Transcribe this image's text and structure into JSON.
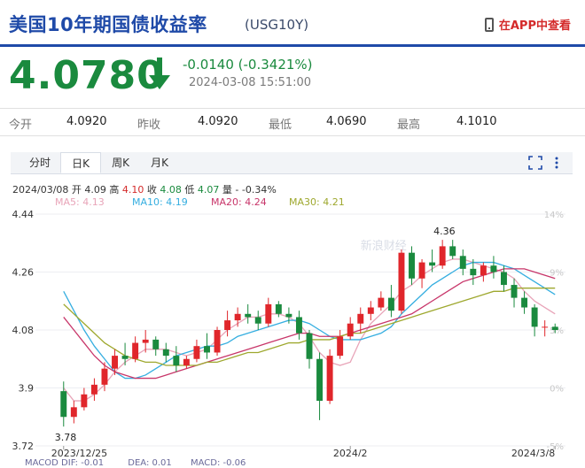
{
  "header": {
    "title": "美国10年期国债收益率",
    "code": "(USG10Y)",
    "app_link": "在APP中查看",
    "app_icon": "phone-icon"
  },
  "quote": {
    "price": "4.0780",
    "change": "-0.0140 (-0.3421%)",
    "datetime": "2024-03-08 15:51:00",
    "direction_icon": "arrow-down-icon",
    "color_down": "#1a8a3e",
    "color_up": "#d42a2a"
  },
  "stats": [
    {
      "label": "今开",
      "value": "4.0920"
    },
    {
      "label": "昨收",
      "value": "4.0920"
    },
    {
      "label": "最低",
      "value": "4.0690"
    },
    {
      "label": "最高",
      "value": "4.1010"
    }
  ],
  "tabs": [
    "分时",
    "日K",
    "周K",
    "月K"
  ],
  "active_tab": "日K",
  "tools": {
    "fullscreen_icon": "expand-icon",
    "more_icon": "more-vertical-icon"
  },
  "ohlc_info": {
    "date": "2024/03/08",
    "open_label": "开",
    "open": "4.09",
    "high_label": "高",
    "high": "4.10",
    "close_label": "收",
    "close": "4.08",
    "low_label": "低",
    "low": "4.07",
    "change_label": "量",
    "change": "- -0.34%"
  },
  "ma_legend": [
    {
      "label": "MA5: 4.13",
      "color": "#e8a4b8"
    },
    {
      "label": "MA10: 4.19",
      "color": "#35aee0"
    },
    {
      "label": "MA20: 4.24",
      "color": "#c8366a"
    },
    {
      "label": "MA30: 4.21",
      "color": "#9ea82e"
    }
  ],
  "watermark": "新浪财经",
  "chart_data": {
    "type": "candlestick",
    "y_ticks_left": [
      "4.44",
      "4.26",
      "4.08",
      "3.9",
      "3.72"
    ],
    "y_ticks_right": [
      "14%",
      "9%",
      "5%",
      "0%",
      "-5%"
    ],
    "x_ticks": [
      "2023/12/25",
      "2024/2",
      "2024/3/8"
    ],
    "ylim": [
      3.72,
      4.44
    ],
    "annotations": [
      {
        "label": "4.36",
        "kind": "high"
      },
      {
        "label": "3.78",
        "kind": "low"
      }
    ],
    "candles": [
      {
        "o": 3.89,
        "h": 3.92,
        "l": 3.78,
        "c": 3.81
      },
      {
        "o": 3.81,
        "h": 3.86,
        "l": 3.79,
        "c": 3.84
      },
      {
        "o": 3.84,
        "h": 3.9,
        "l": 3.83,
        "c": 3.88
      },
      {
        "o": 3.88,
        "h": 3.93,
        "l": 3.86,
        "c": 3.91
      },
      {
        "o": 3.91,
        "h": 3.98,
        "l": 3.89,
        "c": 3.96
      },
      {
        "o": 3.96,
        "h": 4.02,
        "l": 3.94,
        "c": 4.0
      },
      {
        "o": 4.0,
        "h": 4.04,
        "l": 3.97,
        "c": 3.99
      },
      {
        "o": 3.99,
        "h": 4.06,
        "l": 3.98,
        "c": 4.04
      },
      {
        "o": 4.04,
        "h": 4.08,
        "l": 4.01,
        "c": 4.05
      },
      {
        "o": 4.05,
        "h": 4.06,
        "l": 4.0,
        "c": 4.02
      },
      {
        "o": 4.02,
        "h": 4.04,
        "l": 3.98,
        "c": 4.0
      },
      {
        "o": 4.0,
        "h": 4.03,
        "l": 3.95,
        "c": 3.97
      },
      {
        "o": 3.97,
        "h": 4.0,
        "l": 3.96,
        "c": 3.99
      },
      {
        "o": 3.99,
        "h": 4.05,
        "l": 3.98,
        "c": 4.03
      },
      {
        "o": 4.03,
        "h": 4.07,
        "l": 3.99,
        "c": 4.01
      },
      {
        "o": 4.01,
        "h": 4.09,
        "l": 4.0,
        "c": 4.08
      },
      {
        "o": 4.08,
        "h": 4.14,
        "l": 4.06,
        "c": 4.11
      },
      {
        "o": 4.11,
        "h": 4.15,
        "l": 4.09,
        "c": 4.13
      },
      {
        "o": 4.13,
        "h": 4.16,
        "l": 4.1,
        "c": 4.12
      },
      {
        "o": 4.12,
        "h": 4.14,
        "l": 4.08,
        "c": 4.1
      },
      {
        "o": 4.1,
        "h": 4.18,
        "l": 4.09,
        "c": 4.16
      },
      {
        "o": 4.16,
        "h": 4.17,
        "l": 4.12,
        "c": 4.13
      },
      {
        "o": 4.13,
        "h": 4.15,
        "l": 4.1,
        "c": 4.12
      },
      {
        "o": 4.12,
        "h": 4.14,
        "l": 4.05,
        "c": 4.07
      },
      {
        "o": 4.07,
        "h": 4.08,
        "l": 3.96,
        "c": 3.99
      },
      {
        "o": 3.99,
        "h": 4.01,
        "l": 3.8,
        "c": 3.86
      },
      {
        "o": 3.86,
        "h": 4.02,
        "l": 3.85,
        "c": 4.0
      },
      {
        "o": 4.0,
        "h": 4.08,
        "l": 3.99,
        "c": 4.06
      },
      {
        "o": 4.06,
        "h": 4.12,
        "l": 4.05,
        "c": 4.1
      },
      {
        "o": 4.1,
        "h": 4.15,
        "l": 4.07,
        "c": 4.13
      },
      {
        "o": 4.13,
        "h": 4.17,
        "l": 4.11,
        "c": 4.15
      },
      {
        "o": 4.15,
        "h": 4.2,
        "l": 4.14,
        "c": 4.18
      },
      {
        "o": 4.18,
        "h": 4.22,
        "l": 4.12,
        "c": 4.14
      },
      {
        "o": 4.14,
        "h": 4.33,
        "l": 4.13,
        "c": 4.32
      },
      {
        "o": 4.32,
        "h": 4.34,
        "l": 4.22,
        "c": 4.24
      },
      {
        "o": 4.24,
        "h": 4.3,
        "l": 4.21,
        "c": 4.29
      },
      {
        "o": 4.29,
        "h": 4.33,
        "l": 4.26,
        "c": 4.28
      },
      {
        "o": 4.28,
        "h": 4.36,
        "l": 4.27,
        "c": 4.34
      },
      {
        "o": 4.34,
        "h": 4.36,
        "l": 4.3,
        "c": 4.31
      },
      {
        "o": 4.31,
        "h": 4.33,
        "l": 4.25,
        "c": 4.27
      },
      {
        "o": 4.27,
        "h": 4.3,
        "l": 4.22,
        "c": 4.25
      },
      {
        "o": 4.25,
        "h": 4.29,
        "l": 4.23,
        "c": 4.28
      },
      {
        "o": 4.28,
        "h": 4.31,
        "l": 4.24,
        "c": 4.26
      },
      {
        "o": 4.26,
        "h": 4.28,
        "l": 4.2,
        "c": 4.22
      },
      {
        "o": 4.22,
        "h": 4.24,
        "l": 4.15,
        "c": 4.18
      },
      {
        "o": 4.18,
        "h": 4.2,
        "l": 4.13,
        "c": 4.15
      },
      {
        "o": 4.15,
        "h": 4.16,
        "l": 4.06,
        "c": 4.09
      },
      {
        "o": 4.09,
        "h": 4.11,
        "l": 4.06,
        "c": 4.09
      },
      {
        "o": 4.09,
        "h": 4.1,
        "l": 4.07,
        "c": 4.08
      }
    ],
    "ma_series": {
      "MA5": [
        3.9,
        3.86,
        3.86,
        3.88,
        3.91,
        3.95,
        3.98,
        4.0,
        4.02,
        4.02,
        4.02,
        4.01,
        4.0,
        4.01,
        4.02,
        4.05,
        4.08,
        4.1,
        4.12,
        4.12,
        4.13,
        4.13,
        4.12,
        4.1,
        4.06,
        4.01,
        3.98,
        3.97,
        3.98,
        4.05,
        4.1,
        4.13,
        4.16,
        4.2,
        4.22,
        4.25,
        4.27,
        4.29,
        4.3,
        4.3,
        4.29,
        4.28,
        4.27,
        4.26,
        4.24,
        4.2,
        4.17,
        4.15,
        4.13
      ],
      "MA10": [
        4.2,
        4.14,
        4.08,
        4.03,
        3.99,
        3.95,
        3.93,
        3.93,
        3.94,
        3.96,
        3.98,
        4.0,
        4.01,
        4.02,
        4.03,
        4.03,
        4.04,
        4.06,
        4.07,
        4.08,
        4.09,
        4.1,
        4.11,
        4.11,
        4.1,
        4.08,
        4.06,
        4.05,
        4.05,
        4.05,
        4.06,
        4.07,
        4.09,
        4.13,
        4.16,
        4.19,
        4.22,
        4.24,
        4.26,
        4.28,
        4.29,
        4.29,
        4.29,
        4.28,
        4.27,
        4.25,
        4.23,
        4.21,
        4.19
      ],
      "MA20": [
        4.12,
        4.08,
        4.04,
        4.0,
        3.97,
        3.95,
        3.94,
        3.93,
        3.93,
        3.93,
        3.94,
        3.95,
        3.96,
        3.97,
        3.98,
        3.99,
        4.0,
        4.01,
        4.02,
        4.03,
        4.04,
        4.05,
        4.06,
        4.07,
        4.07,
        4.06,
        4.06,
        4.06,
        4.07,
        4.08,
        4.09,
        4.1,
        4.11,
        4.12,
        4.13,
        4.15,
        4.17,
        4.19,
        4.21,
        4.23,
        4.24,
        4.25,
        4.26,
        4.27,
        4.27,
        4.27,
        4.26,
        4.25,
        4.24
      ],
      "MA30": [
        4.16,
        4.13,
        4.1,
        4.07,
        4.04,
        4.02,
        4.0,
        3.99,
        3.98,
        3.98,
        3.97,
        3.97,
        3.97,
        3.97,
        3.98,
        3.98,
        3.99,
        4.0,
        4.01,
        4.01,
        4.02,
        4.03,
        4.04,
        4.04,
        4.05,
        4.05,
        4.05,
        4.06,
        4.07,
        4.07,
        4.08,
        4.09,
        4.1,
        4.11,
        4.12,
        4.13,
        4.14,
        4.15,
        4.16,
        4.17,
        4.18,
        4.19,
        4.2,
        4.2,
        4.21,
        4.21,
        4.21,
        4.21,
        4.21
      ]
    }
  },
  "subchart": {
    "label": "MACOD",
    "dif": "DIF: -0.01",
    "dea": "DEA: 0.01",
    "macd": "MACD: -0.06"
  }
}
